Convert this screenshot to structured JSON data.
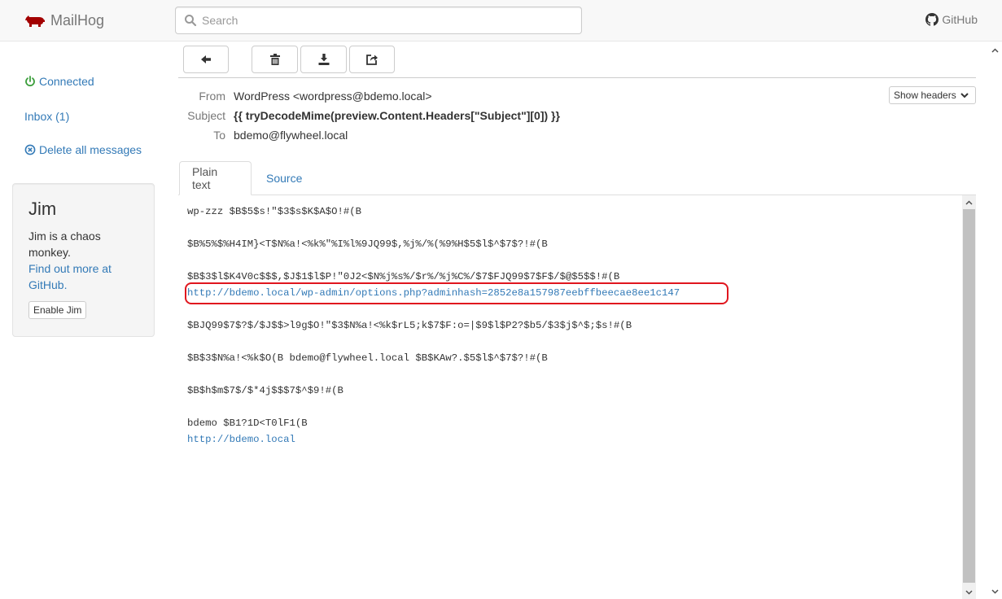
{
  "navbar": {
    "brand": "MailHog",
    "search_placeholder": "Search",
    "github_label": "GitHub",
    "brand_color": "#a30000"
  },
  "sidebar": {
    "connected": "Connected",
    "inbox": "Inbox (1)",
    "delete_all": "Delete all messages",
    "connected_color": "#3c9e3c"
  },
  "jim": {
    "title": "Jim",
    "text": "Jim is a chaos monkey.",
    "link": "Find out more at GitHub.",
    "button": "Enable Jim"
  },
  "toolbar": {
    "back": "arrow-left-icon",
    "delete": "trash-icon",
    "download": "download-icon",
    "release": "release-icon"
  },
  "message": {
    "from_label": "From",
    "from": "WordPress <wordpress@bdemo.local>",
    "subject_label": "Subject",
    "subject": "{{ tryDecodeMime(preview.Content.Headers[\"Subject\"][0]) }}",
    "to_label": "To",
    "to": "bdemo@flywheel.local",
    "show_headers": "Show headers"
  },
  "tabs": {
    "plain": "Plain text",
    "source": "Source"
  },
  "body": {
    "lines": [
      "wp-zzz $B$5$s!\"$3$s$K$A$O!#(B",
      "$B%5%$%H4IM}<T$N%a!<%k%\"%I%l%9JQ99$,%j%/%(%9%H$5$l$^$7$?!#(B",
      "$B$3$l$K4V0c$$$,$J$1$l$P!\"0J2<$N%j%s%/$r%/%j%C%/$7$FJQ99$7$F$/$@$5$$!#(B",
      "http://bdemo.local/wp-admin/options.php?adminhash=2852e8a157987eebffbeecae8ee1c147",
      "$BJQ99$7$?$/$J$$>l9g$O!\"$3$N%a!<%k$rL5;k$7$F:o=|$9$l$P2?$b5/$3$j$^$;$s!#(B",
      "$B$3$N%a!<%k$O(B bdemo@flywheel.local $B$KAw?.$5$l$^$7$?!#(B",
      "$B$h$m$7$/$*4j$$$7$^$9!#(B",
      "bdemo $B1?1D<T0lF1(B",
      "http://bdemo.local"
    ]
  }
}
